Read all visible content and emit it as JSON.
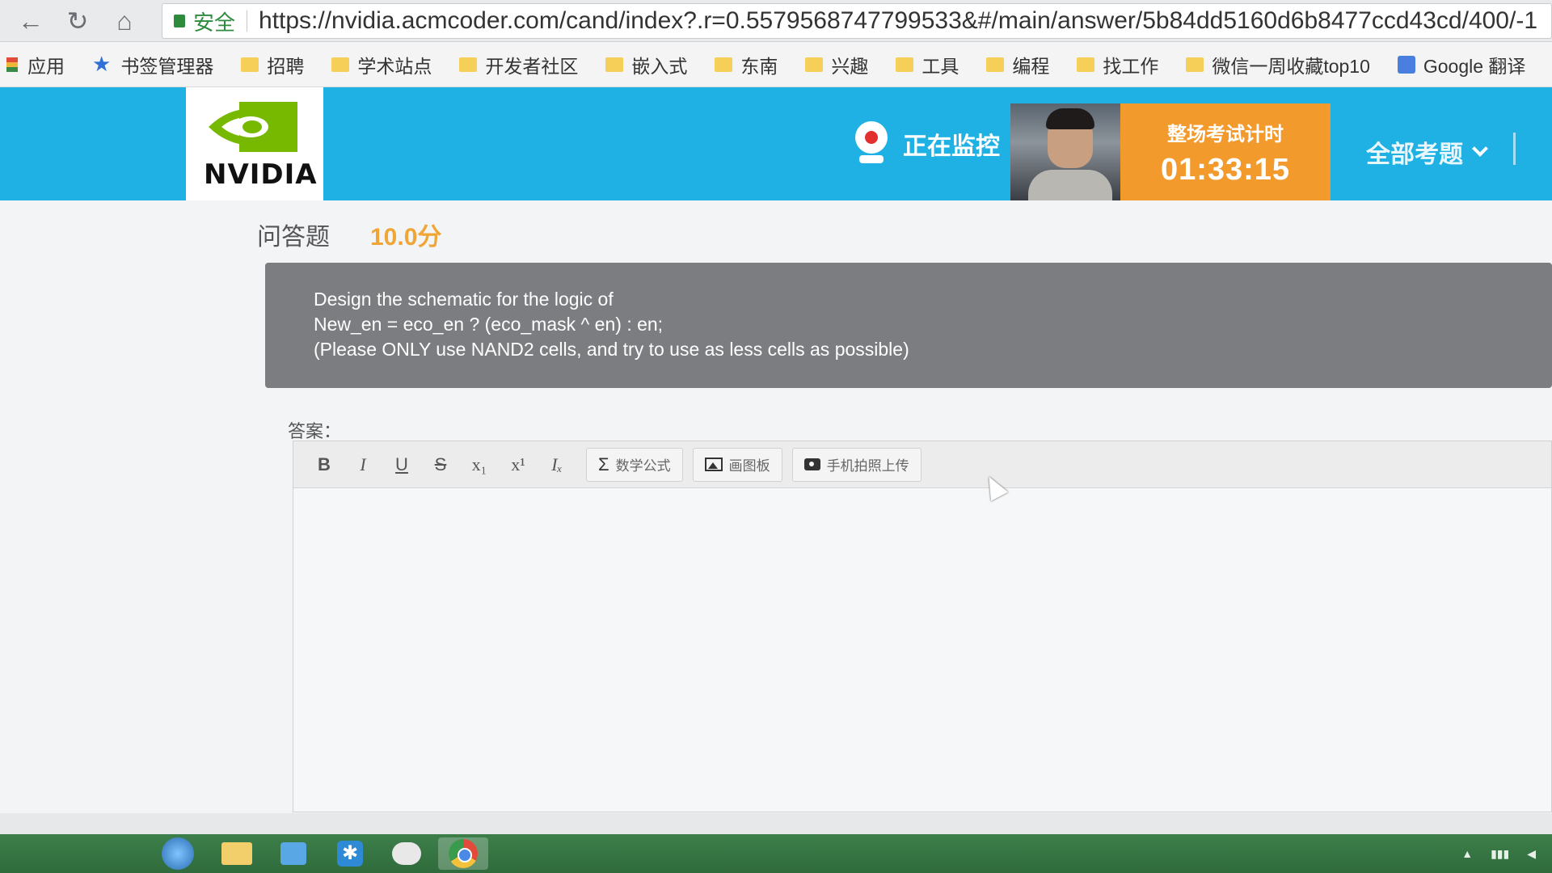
{
  "browser": {
    "secure_label": "安全",
    "url": "https://nvidia.acmcoder.com/cand/index?.r=0.5579568747799533&#/main/answer/5b84dd5160d6b8477ccd43cd/400/-1",
    "bookmarks": [
      {
        "icon": "apps-icon",
        "label": "应用"
      },
      {
        "icon": "star-icon",
        "label": "书签管理器"
      },
      {
        "icon": "folder-icon",
        "label": "招聘"
      },
      {
        "icon": "folder-icon",
        "label": "学术站点"
      },
      {
        "icon": "folder-icon",
        "label": "开发者社区"
      },
      {
        "icon": "folder-icon",
        "label": "嵌入式"
      },
      {
        "icon": "folder-icon",
        "label": "东南"
      },
      {
        "icon": "folder-icon",
        "label": "兴趣"
      },
      {
        "icon": "folder-icon",
        "label": "工具"
      },
      {
        "icon": "folder-icon",
        "label": "编程"
      },
      {
        "icon": "folder-icon",
        "label": "找工作"
      },
      {
        "icon": "folder-icon",
        "label": "微信一周收藏top10"
      },
      {
        "icon": "translate-icon",
        "label": "Google 翻译"
      }
    ]
  },
  "header": {
    "logo_text": "NVIDIA",
    "monitor_label": "正在监控",
    "timer_label": "整场考试计时",
    "timer_value": "01:33:15",
    "all_questions_label": "全部考题",
    "accent_color": "#1fb1e3",
    "timer_color": "#f39a2c"
  },
  "question": {
    "type_label": "问答题",
    "score": "10.0分",
    "lines": [
      "Design the schematic for the logic of",
      "New_en = eco_en ? (eco_mask ^ en) : en;",
      "(Please ONLY use NAND2 cells, and try to use as less cells as possible)"
    ]
  },
  "answer": {
    "label": "答案：",
    "toolbar": {
      "bold": "B",
      "italic": "I",
      "underline": "U",
      "strike": "S",
      "subscript": "x₁",
      "superscript": "x¹",
      "clear_format": "Iₓ",
      "math_label": "数学公式",
      "drawing_label": "画图板",
      "phone_upload_label": "手机拍照上传"
    }
  }
}
